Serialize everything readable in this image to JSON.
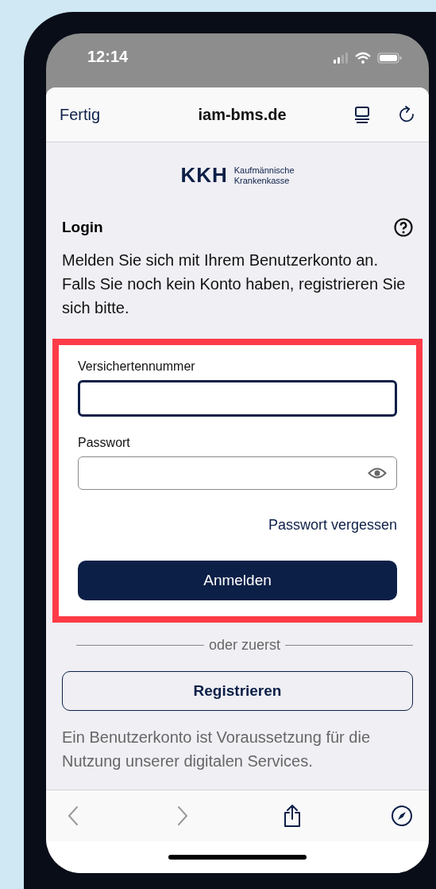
{
  "status_bar": {
    "time": "12:14"
  },
  "browser_header": {
    "done": "Fertig",
    "domain": "iam-bms.de"
  },
  "logo": {
    "mark": "KKH",
    "line_1": "Kaufmännische",
    "line_2": "Krankenkasse"
  },
  "login": {
    "title": "Login",
    "intro": "Melden Sie sich mit Ihrem Benutzerkonto an. Falls Sie noch kein Konto haben, registrieren Sie sich bitte."
  },
  "form": {
    "highlighted": true,
    "fields": [
      {
        "label": "Versichertennummer",
        "kind": "text",
        "focused": true
      },
      {
        "label": "Passwort",
        "kind": "password",
        "focused": false
      }
    ],
    "forgot_link": "Passwort vergessen",
    "submit": "Anmelden"
  },
  "divider": "oder zuerst",
  "register_button": "Registrieren",
  "note": "Ein Benutzerkonto ist Voraussetzung für die Nutzung unserer digitalen Services.",
  "toolbar": [
    {
      "kind": "back",
      "disabled": true
    },
    {
      "kind": "forward",
      "disabled": true
    },
    {
      "kind": "share",
      "disabled": false
    },
    {
      "kind": "compass",
      "disabled": false
    }
  ]
}
